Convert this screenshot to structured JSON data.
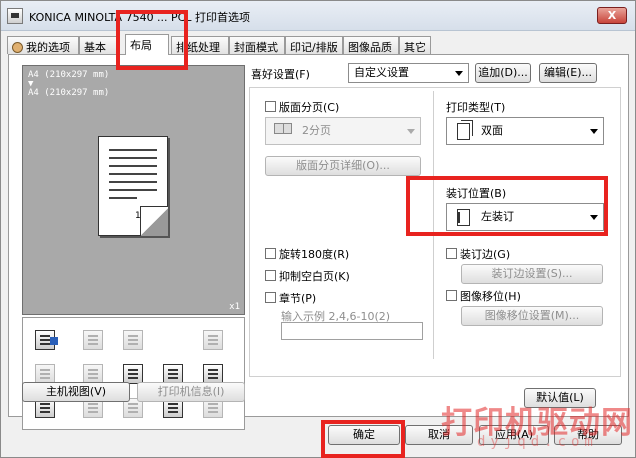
{
  "window": {
    "title": "KONICA MINOLTA 7540 ... PCL 打印首选项",
    "close_label": "X"
  },
  "tabs": [
    {
      "label": "我的选项",
      "name": "tab-my-options"
    },
    {
      "label": "基本",
      "name": "tab-basic"
    },
    {
      "label": "布局",
      "name": "tab-layout"
    },
    {
      "label": "排纸处理",
      "name": "tab-finishing"
    },
    {
      "label": "封面模式",
      "name": "tab-cover"
    },
    {
      "label": "印记/排版",
      "name": "tab-stamp"
    },
    {
      "label": "图像品质",
      "name": "tab-quality"
    },
    {
      "label": "其它",
      "name": "tab-other"
    }
  ],
  "preview": {
    "line1": "A4 (210x297 mm)",
    "line2": "A4 (210x297 mm)",
    "page_number": "1",
    "scale": "x1"
  },
  "left_buttons": {
    "printer_view": "主机视图(V)",
    "printer_info": "打印机信息(I)"
  },
  "favorites": {
    "label": "喜好设置(F)",
    "value": "自定义设置",
    "add": "追加(D)...",
    "edit": "编辑(E)..."
  },
  "combination": {
    "label": "版面分页(C)",
    "value": "2分页",
    "detail": "版面分页详细(O)..."
  },
  "print_type": {
    "label": "打印类型(T)",
    "value": "双面"
  },
  "binding": {
    "label": "装订位置(B)",
    "value": "左装订"
  },
  "checks": {
    "rotate": "旋转180度(R)",
    "skip_blank": "抑制空白页(K)",
    "chapter": "章节(P)",
    "chapter_hint": "输入示例 2,4,6-10(2)",
    "binding_margin": "装订边(G)",
    "binding_margin_settings": "装订边设置(S)...",
    "image_shift": "图像移位(H)",
    "image_shift_settings": "图像移位设置(M)..."
  },
  "default_button": "默认值(L)",
  "footer": {
    "ok": "确定",
    "cancel": "取消",
    "apply": "应用(A)",
    "help": "帮助"
  },
  "watermark": {
    "text": "打印机驱动网",
    "url": "dyjqd.com"
  },
  "colors": {
    "highlight": "#e8231f",
    "titlebar": "#d6dfea"
  }
}
